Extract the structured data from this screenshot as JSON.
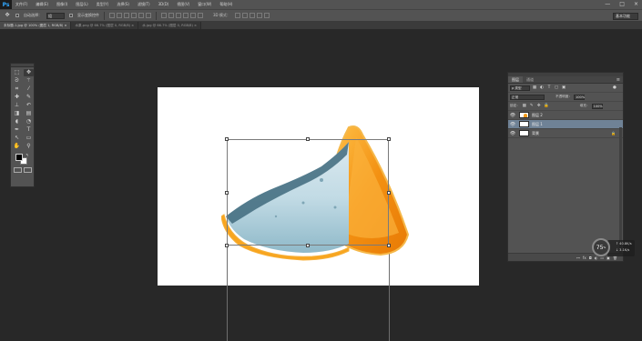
{
  "app": {
    "logo": "Ps"
  },
  "menu": [
    "文件(F)",
    "编辑(E)",
    "图像(I)",
    "图层(L)",
    "类型(Y)",
    "选择(S)",
    "滤镜(T)",
    "3D(D)",
    "视图(V)",
    "窗口(W)",
    "帮助(H)"
  ],
  "window_controls": [
    "—",
    "□",
    "×"
  ],
  "options": {
    "auto_select_label": "自动选择：",
    "auto_select_value": "组",
    "show_transform_label": "显示变换控件",
    "mode_label": "3D 模式：",
    "workspace": "基本功能"
  },
  "tabs": [
    {
      "label": "未标题-1.jpg @ 100% (图层 1, RGB/8) ×",
      "active": true
    },
    {
      "label": "水果.png @ 66.7% (图层 0, RGB/8) ×",
      "active": false
    },
    {
      "label": "水.jpg @ 66.7% (图层 0, RGB/8) ×",
      "active": false
    }
  ],
  "layers_panel": {
    "tabs": [
      "图层",
      "通道"
    ],
    "menu_icon": "≡",
    "filter_label": "ρ 类型",
    "blend_mode": "正常",
    "opacity_label": "不透明度：",
    "opacity_value": "100%",
    "lock_label": "锁定：",
    "fill_label": "填充：",
    "fill_value": "100%",
    "layers": [
      {
        "name": "图层 2",
        "selected": false,
        "thumb": "orange"
      },
      {
        "name": "图层 1",
        "selected": true,
        "thumb": "white"
      },
      {
        "name": "背景",
        "selected": false,
        "thumb": "white",
        "locked": true
      }
    ],
    "bottom_icons": [
      "⊶",
      "fx",
      "◘",
      "◐",
      "▭",
      "▣",
      "🗑"
    ]
  },
  "speed_widget": {
    "percent": "75",
    "percent_sign": "%",
    "up": "↑ 40.8K/s",
    "down": "↓ 3.1K/s"
  }
}
